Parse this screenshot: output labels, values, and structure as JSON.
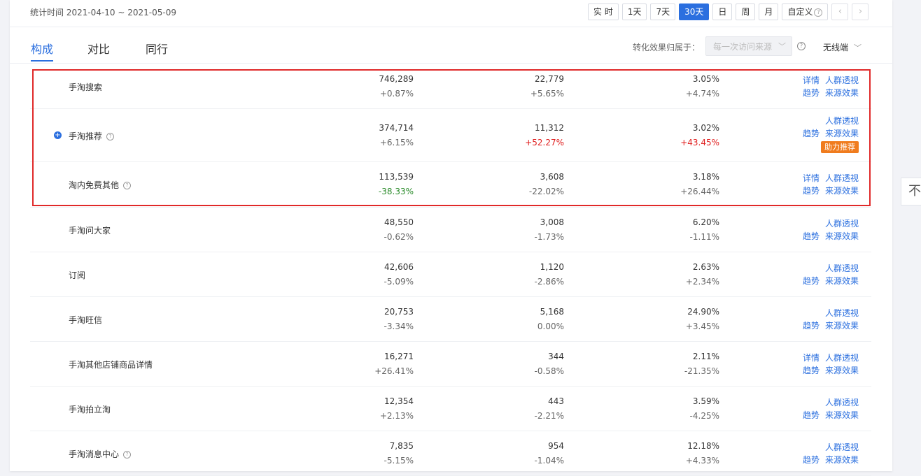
{
  "header": {
    "stat_time": "统计时间 2021-04-10 ~ 2021-05-09",
    "ranges": [
      {
        "label": "实 时",
        "active": false
      },
      {
        "label": "1天",
        "active": false
      },
      {
        "label": "7天",
        "active": false
      },
      {
        "label": "30天",
        "active": true
      },
      {
        "label": "日",
        "active": false
      },
      {
        "label": "周",
        "active": false
      },
      {
        "label": "月",
        "active": false
      }
    ],
    "custom_label": "自定义",
    "prev_icon": "chevron-left-icon",
    "next_icon": "chevron-right-icon"
  },
  "tabs": [
    {
      "label": "构成",
      "active": true
    },
    {
      "label": "对比",
      "active": false
    },
    {
      "label": "同行",
      "active": false
    }
  ],
  "attribution": {
    "label": "转化效果归属于：",
    "selected": "每一次访问来源",
    "device": "无线端"
  },
  "op_labels": {
    "detail": "详情",
    "trend": "趋势",
    "crowd": "人群透视",
    "effect": "来源效果",
    "boost": "助力推荐"
  },
  "rows": [
    {
      "name": "手淘搜索",
      "help": false,
      "expandable": false,
      "m1": "746,289",
      "d1": "+0.87%",
      "d1c": "",
      "m2": "22,779",
      "d2": "+5.65%",
      "d2c": "",
      "m3": "3.05%",
      "d3": "+4.74%",
      "d3c": "",
      "has_detail": true,
      "boost": false
    },
    {
      "name": "手淘推荐",
      "help": true,
      "expandable": true,
      "m1": "374,714",
      "d1": "+6.15%",
      "d1c": "",
      "m2": "11,312",
      "d2": "+52.27%",
      "d2c": "red",
      "m3": "3.02%",
      "d3": "+43.45%",
      "d3c": "red",
      "has_detail": false,
      "boost": true
    },
    {
      "name": "淘内免费其他",
      "help": true,
      "expandable": false,
      "m1": "113,539",
      "d1": "-38.33%",
      "d1c": "green",
      "m2": "3,608",
      "d2": "-22.02%",
      "d2c": "",
      "m3": "3.18%",
      "d3": "+26.44%",
      "d3c": "",
      "has_detail": true,
      "boost": false
    },
    {
      "name": "手淘问大家",
      "help": false,
      "expandable": false,
      "m1": "48,550",
      "d1": "-0.62%",
      "d1c": "",
      "m2": "3,008",
      "d2": "-1.73%",
      "d2c": "",
      "m3": "6.20%",
      "d3": "-1.11%",
      "d3c": "",
      "has_detail": false,
      "boost": false
    },
    {
      "name": "订阅",
      "help": false,
      "expandable": false,
      "m1": "42,606",
      "d1": "-5.09%",
      "d1c": "",
      "m2": "1,120",
      "d2": "-2.86%",
      "d2c": "",
      "m3": "2.63%",
      "d3": "+2.34%",
      "d3c": "",
      "has_detail": false,
      "boost": false
    },
    {
      "name": "手淘旺信",
      "help": false,
      "expandable": false,
      "m1": "20,753",
      "d1": "-3.34%",
      "d1c": "",
      "m2": "5,168",
      "d2": "0.00%",
      "d2c": "",
      "m3": "24.90%",
      "d3": "+3.45%",
      "d3c": "",
      "has_detail": false,
      "boost": false
    },
    {
      "name": "手淘其他店铺商品详情",
      "help": false,
      "expandable": false,
      "m1": "16,271",
      "d1": "+26.41%",
      "d1c": "",
      "m2": "344",
      "d2": "-0.58%",
      "d2c": "",
      "m3": "2.11%",
      "d3": "-21.35%",
      "d3c": "",
      "has_detail": true,
      "boost": false
    },
    {
      "name": "手淘拍立淘",
      "help": false,
      "expandable": false,
      "m1": "12,354",
      "d1": "+2.13%",
      "d1c": "",
      "m2": "443",
      "d2": "-2.21%",
      "d2c": "",
      "m3": "3.59%",
      "d3": "-4.25%",
      "d3c": "",
      "has_detail": false,
      "boost": false
    },
    {
      "name": "手淘消息中心",
      "help": true,
      "expandable": false,
      "m1": "7,835",
      "d1": "-5.15%",
      "d1c": "",
      "m2": "954",
      "d2": "-1.04%",
      "d2c": "",
      "m3": "12.18%",
      "d3": "+4.33%",
      "d3c": "",
      "has_detail": false,
      "boost": false
    }
  ],
  "colors": {
    "accent": "#2b6fdf",
    "highlight": "#e02929",
    "negative_up": "#e02020",
    "positive_down": "#2c8c2c",
    "boost": "#f07c1e"
  },
  "side": {
    "back_top_icon": "back-to-top-icon",
    "glyph": "不"
  }
}
